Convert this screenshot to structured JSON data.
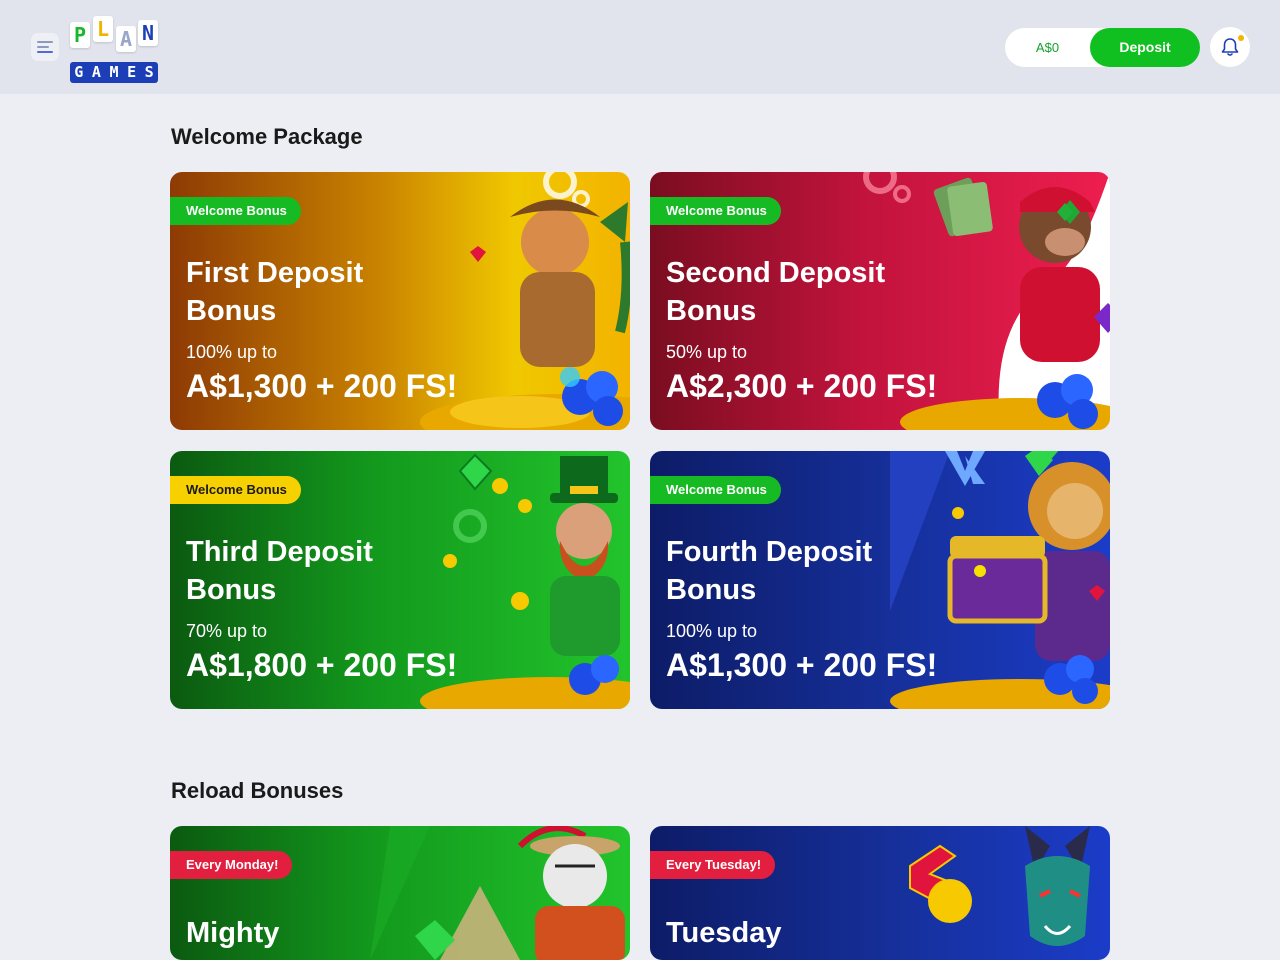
{
  "header": {
    "logo_letters": [
      "P",
      "L",
      "A",
      "N"
    ],
    "logo_word": [
      "G",
      "A",
      "M",
      "E",
      "S"
    ],
    "balance": "A$0",
    "deposit_label": "Deposit"
  },
  "sections": {
    "welcome_title": "Welcome Package",
    "reload_title": "Reload Bonuses"
  },
  "welcome_cards": [
    {
      "badge": "Welcome Bonus",
      "title": "First Deposit Bonus",
      "subtitle": "100% up to",
      "amount": "A$1,300 + 200 FS!"
    },
    {
      "badge": "Welcome Bonus",
      "title": "Second Deposit Bonus",
      "subtitle": "50% up to",
      "amount": "A$2,300 + 200 FS!"
    },
    {
      "badge": "Welcome Bonus",
      "title": "Third Deposit Bonus",
      "subtitle": "70% up to",
      "amount": "A$1,800 + 200 FS!"
    },
    {
      "badge": "Welcome Bonus",
      "title": "Fourth Deposit Bonus",
      "subtitle": "100% up to",
      "amount": "A$1,300 + 200 FS!"
    }
  ],
  "reload_cards": [
    {
      "badge": "Every Monday!",
      "title": "Mighty"
    },
    {
      "badge": "Every Tuesday!",
      "title": "Tuesday"
    }
  ],
  "colors": {
    "accent_green": "#10c020",
    "badge_yellow": "#f7d000",
    "badge_red": "#e21f3f",
    "brand_blue": "#1c3fb8"
  },
  "icons": [
    "menu-icon",
    "bell-icon"
  ]
}
